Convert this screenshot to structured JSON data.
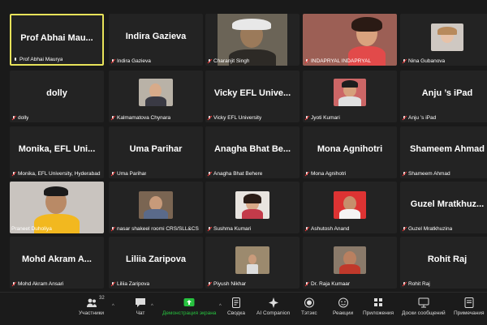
{
  "participants": [
    {
      "name": "Prof Abhai Maurya",
      "tile_title": "Prof Abhai Mau...",
      "mic": "on",
      "active": true
    },
    {
      "name": "Indira Gazieva",
      "tile_title": "Indira Gazieva",
      "mic": "muted"
    },
    {
      "name": "Charanjit Singh",
      "video": true,
      "mic": "muted"
    },
    {
      "name": "INDAPRYAL INDAPRYAL",
      "video": true,
      "mic": "muted"
    },
    {
      "name": "Nina Gubanova",
      "video": true,
      "mic": "muted"
    },
    {
      "name": "dolly",
      "tile_title": "dolly",
      "mic": "muted"
    },
    {
      "name": "Kalmamatova Chynara",
      "video": true,
      "mic": "muted"
    },
    {
      "name": "Vicky EFL University",
      "tile_title": "Vicky EFL Unive...",
      "mic": "muted"
    },
    {
      "name": "Jyoti Kumari",
      "video": true,
      "mic": "muted"
    },
    {
      "name": "Anju ’s iPad",
      "tile_title": "Anju ’s iPad",
      "mic": "muted"
    },
    {
      "name": "Monika, EFL University, Hyderabad",
      "tile_title": "Monika, EFL Uni...",
      "mic": "muted"
    },
    {
      "name": "Uma Parihar",
      "tile_title": "Uma Parihar",
      "mic": "muted"
    },
    {
      "name": "Anagha Bhat Behere",
      "tile_title": "Anagha Bhat Be...",
      "mic": "muted"
    },
    {
      "name": "Mona Agnihotri",
      "tile_title": "Mona Agnihotri",
      "mic": "muted"
    },
    {
      "name": "Shameem Ahmad",
      "tile_title": "Shameem Ahmad",
      "mic": "muted"
    },
    {
      "name": "Praneet Duholiya",
      "video": true,
      "mic": "none"
    },
    {
      "name": "nasar shakeel roomi CRS/SLL&CS",
      "video": true,
      "mic": "muted"
    },
    {
      "name": "Sushma Kumari",
      "video": true,
      "mic": "muted"
    },
    {
      "name": "Ashutosh Anand",
      "video": true,
      "mic": "muted"
    },
    {
      "name": "Guzel Mratkhuzina",
      "tile_title": "Guzel Mratkhuz...",
      "mic": "muted"
    },
    {
      "name": "Mohd Akram Ansari",
      "tile_title": "Mohd Akram A...",
      "mic": "muted"
    },
    {
      "name": "Liliia Zaripova",
      "tile_title": "Liliia Zaripova",
      "mic": "muted"
    },
    {
      "name": "Piyush Nikhar",
      "video": true,
      "mic": "muted"
    },
    {
      "name": "Dr. Raja Kumaar",
      "video": true,
      "mic": "muted"
    },
    {
      "name": "Rohit Raj",
      "tile_title": "Rohit Raj",
      "mic": "muted"
    }
  ],
  "toolbar": {
    "participants_label": "Участники",
    "participants_count": "32",
    "chat_label": "Чат",
    "share_label": "Демонстрация экрана",
    "notes_label": "Сводка",
    "ai_label": "AI Companion",
    "leave_label": "Тэтэкс",
    "reactions_label": "Реакции",
    "apps_label": "Приложения",
    "whiteboard_label": "Доски сообщений",
    "notes2_label": "Примечания"
  },
  "colors": {
    "active_border": "#e8e35a",
    "share_green": "#27c23f",
    "muted_red": "#e33"
  }
}
